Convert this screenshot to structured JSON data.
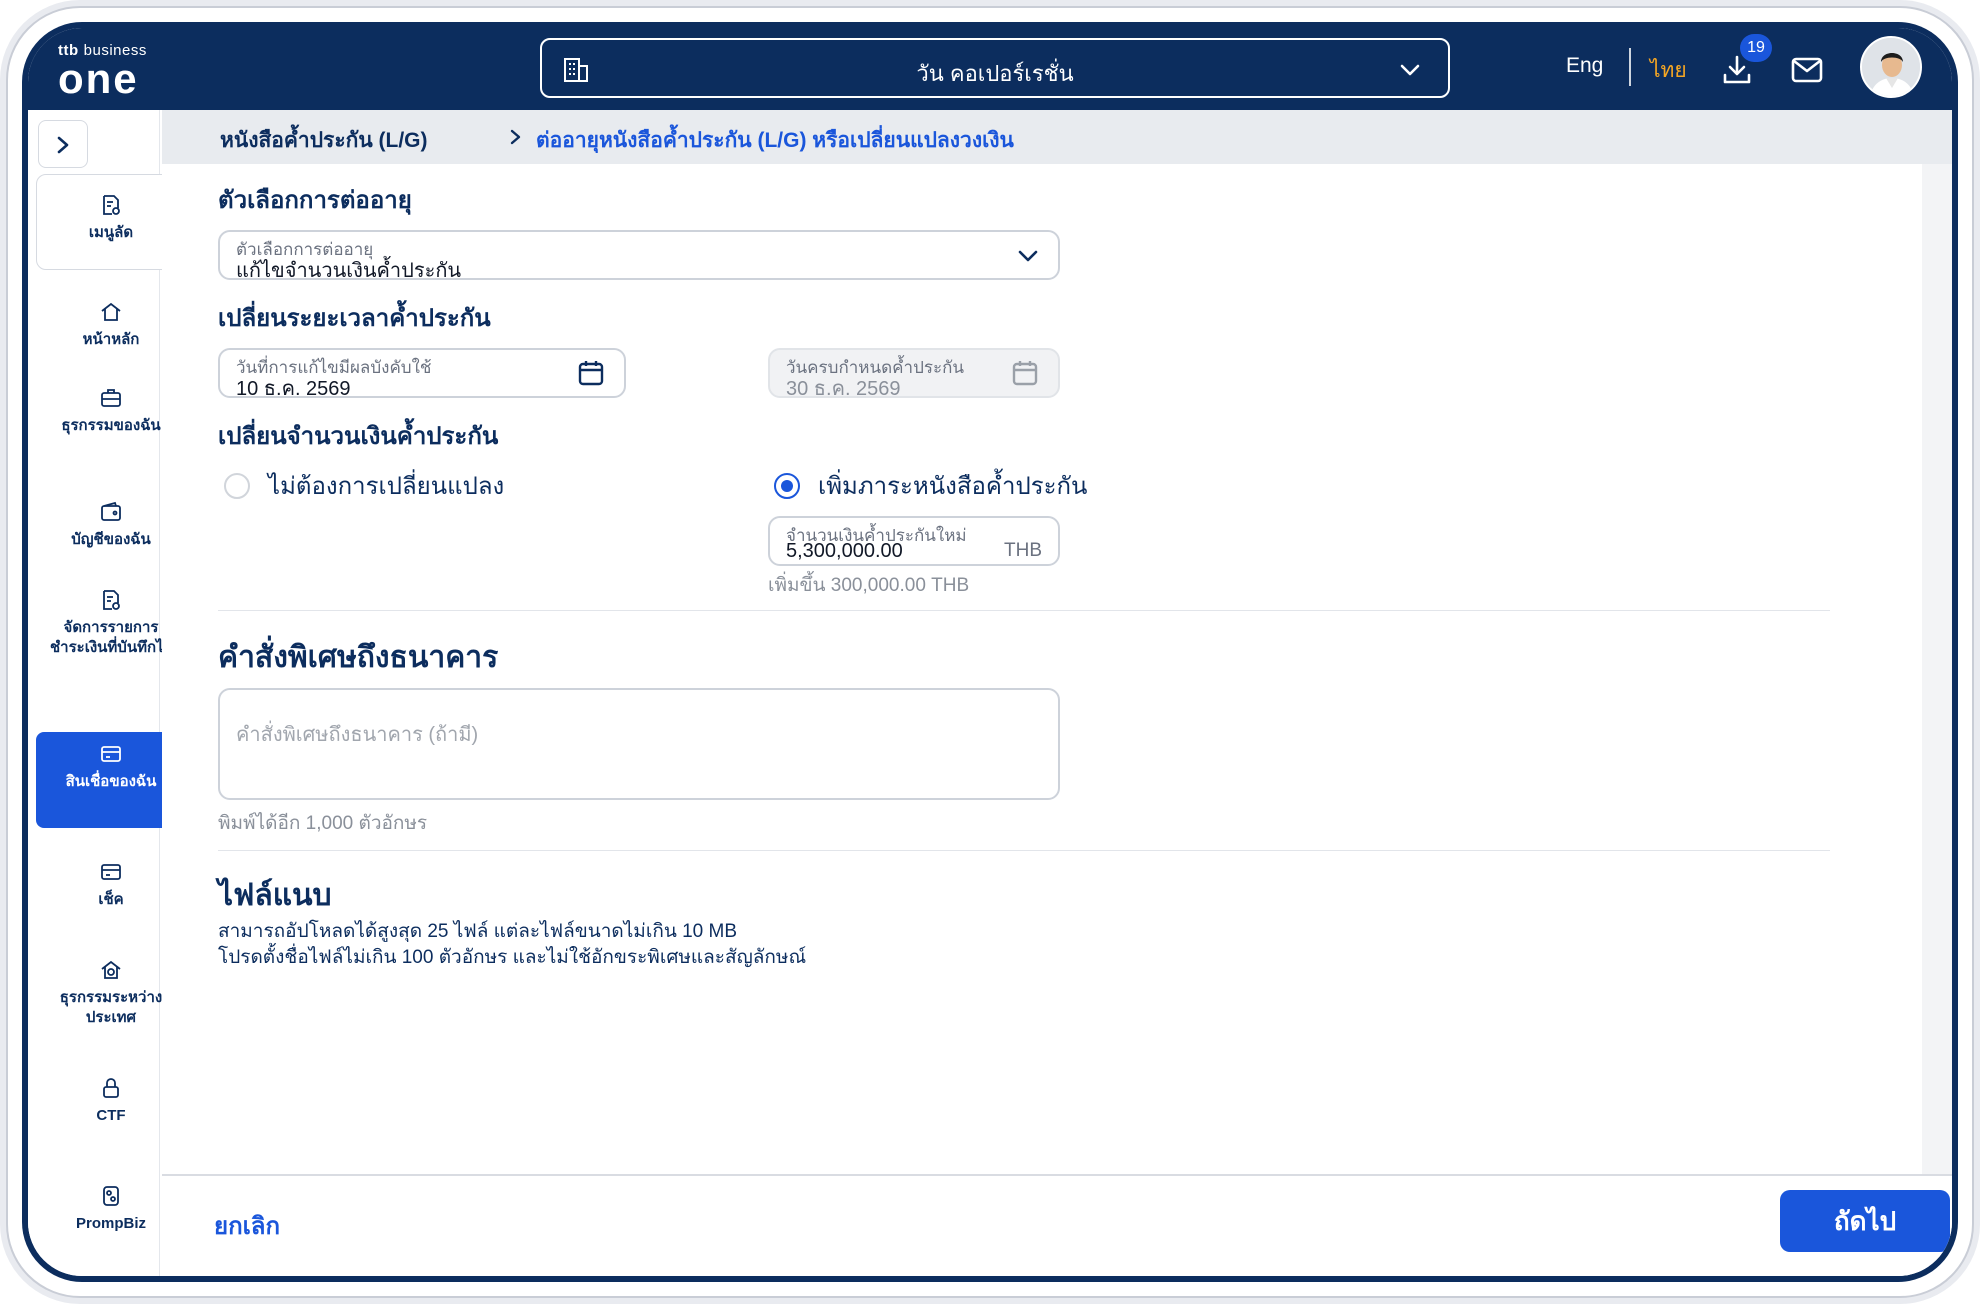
{
  "brand": {
    "prefix": "ttb",
    "suffix": "business",
    "name": "one"
  },
  "header": {
    "company": "วัน คอเปอร์เรชั่น",
    "lang_en": "Eng",
    "lang_th": "ไทย",
    "download_badge": "19"
  },
  "sidebar": {
    "items": [
      {
        "label": "เมนูลัด"
      },
      {
        "label": "หน้าหลัก"
      },
      {
        "label": "ธุรกรรมของฉัน"
      },
      {
        "label": "บัญชีของฉัน"
      },
      {
        "label": "จัดการรายการชำระเงินที่บันทึกไว้"
      },
      {
        "label": "สินเชื่อของฉัน"
      },
      {
        "label": "เช็ค"
      },
      {
        "label": "ธุรกรรมระหว่างประเทศ"
      },
      {
        "label": "CTF"
      },
      {
        "label": "PrompBiz"
      }
    ]
  },
  "breadcrumb": {
    "parent": "หนังสือค้ำประกัน (L/G)",
    "current": "ต่ออายุหนังสือค้ำประกัน (L/G) หรือเปลี่ยนแปลงวงเงิน"
  },
  "renewal": {
    "title": "ตัวเลือกการต่ออายุ",
    "option_label": "ตัวเลือกการต่ออายุ",
    "option_value": "แก้ไขจำนวนเงินค้ำประกัน"
  },
  "period": {
    "title": "เปลี่ยนระยะเวลาค้ำประกัน",
    "effective_label": "วันที่การแก้ไขมีผลบังคับใช้",
    "effective_value": "10 ธ.ค. 2569",
    "expiry_label": "วันครบกำหนดค้ำประกัน",
    "expiry_value": "30 ธ.ค. 2569"
  },
  "amount": {
    "title": "เปลี่ยนจำนวนเงินค้ำประกัน",
    "option_no_change": "ไม่ต้องการเปลี่ยนแปลง",
    "option_increase": "เพิ่มภาระหนังสือค้ำประกัน",
    "new_amount_label": "จำนวนเงินค้ำประกันใหม่",
    "new_amount_value": "5,300,000.00",
    "currency": "THB",
    "increase_note": "เพิ่มขึ้น 300,000.00 THB"
  },
  "instruction": {
    "title": "คำสั่งพิเศษถึงธนาคาร",
    "placeholder": "คำสั่งพิเศษถึงธนาคาร (ถ้ามี)",
    "counter": "พิมพ์ได้อีก 1,000 ตัวอักษร"
  },
  "attachments": {
    "title": "ไฟล์แนบ",
    "line1": "สามารถอัปโหลดได้สูงสุด 25 ไฟล์ แต่ละไฟล์ขนาดไม่เกิน 10 MB",
    "line2": "โปรดตั้งชื่อไฟล์ไม่เกิน 100 ตัวอักษร และไม่ใช้อักขระพิเศษและสัญลักษณ์"
  },
  "footer": {
    "cancel": "ยกเลิก",
    "next": "ถัดไป"
  },
  "colors": {
    "navy": "#0c2d5e",
    "primary": "#1a56db",
    "accent": "#f5a623"
  }
}
